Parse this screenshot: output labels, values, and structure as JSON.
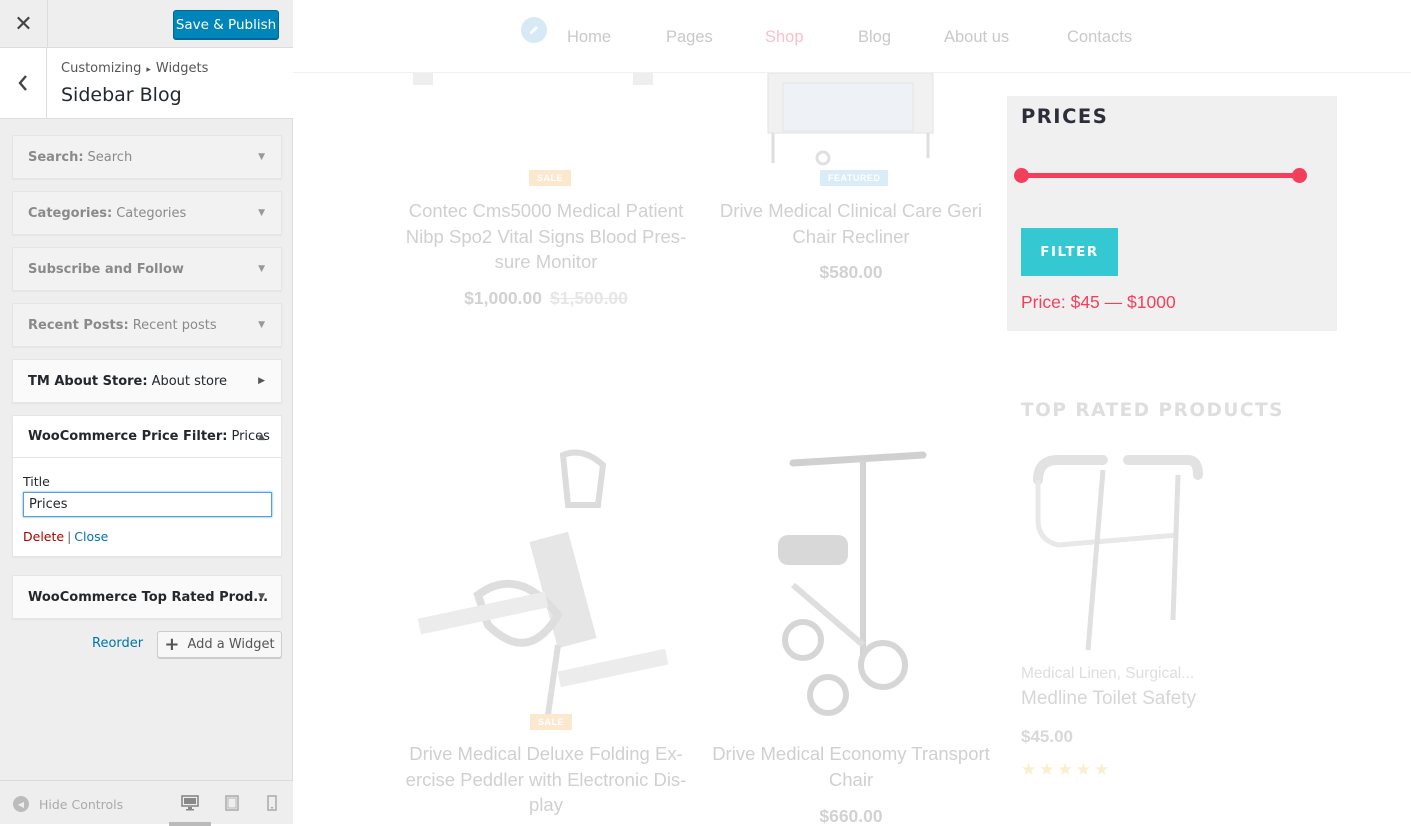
{
  "customizer": {
    "close_label": "✕",
    "save_label": "Save & Publish",
    "breadcrumb": {
      "root": "Customizing",
      "separator": "▸",
      "section": "Widgets"
    },
    "section_title": "Sidebar Blog",
    "widgets": [
      {
        "type": "Search:",
        "title": "Search",
        "state": "collapsed",
        "dim": true
      },
      {
        "type": "Categories:",
        "title": "Categories",
        "state": "collapsed",
        "dim": true
      },
      {
        "type": "Subscribe and Follow",
        "title": "",
        "state": "collapsed",
        "dim": true
      },
      {
        "type": "Recent Posts:",
        "title": "Recent posts",
        "state": "collapsed",
        "dim": true
      },
      {
        "type": "TM About Store:",
        "title": "About store",
        "state": "collapsed",
        "dim": false
      },
      {
        "type": "WooCommerce Price Filter:",
        "title": "Prices",
        "state": "expanded",
        "dim": false
      },
      {
        "type": "WooCommerce Top Rated Prod...",
        "title": "",
        "state": "collapsed",
        "dim": false
      }
    ],
    "expanded_widget": {
      "field_label": "Title",
      "field_value": "Prices",
      "delete_label": "Delete",
      "separator": "|",
      "close_label": "Close"
    },
    "reorder_label": "Reorder",
    "add_widget_label": "Add a Widget",
    "hide_controls_label": "Hide Controls",
    "devices": [
      "desktop",
      "tablet",
      "mobile"
    ],
    "active_device": "desktop",
    "colors": {
      "primary": "#0085ba",
      "link": "#0073aa",
      "delete": "#aa0000"
    }
  },
  "preview": {
    "nav": [
      "Home",
      "Pages",
      "Shop",
      "Blog",
      "About us",
      "Contacts"
    ],
    "nav_current": "Shop",
    "products": [
      {
        "badge": "SALE",
        "title": "Contec Cms5000 Medical Patient Nibp Spo2 Vital Signs Blood Pres-sure Monitor",
        "price": "$1,000.00",
        "old_price": "$1,500.00"
      },
      {
        "badge": "FEATURED",
        "title": "Drive Medical Clinical Care Geri Chair Recliner",
        "price": "$580.00"
      },
      {
        "badge": "SALE",
        "title": "Drive Medical Deluxe Folding Ex-ercise Peddler with Electronic Dis-play",
        "price": ""
      },
      {
        "badge": "",
        "title": "Drive Medical Economy Transport Chair",
        "price": "$660.00"
      }
    ],
    "price_filter": {
      "title": "PRICES",
      "button_label": "FILTER",
      "range_label": "Price: $45 — $1000",
      "min": 45,
      "max": 1000,
      "accent": "#f33f5c",
      "button_color": "#33c8d2"
    },
    "top_rated": {
      "title": "TOP RATED PRODUCTS",
      "category": "Medical Linen, Surgical...",
      "name": "Medline Toilet Safety",
      "price": "$45.00",
      "stars": "★★★★★"
    }
  }
}
